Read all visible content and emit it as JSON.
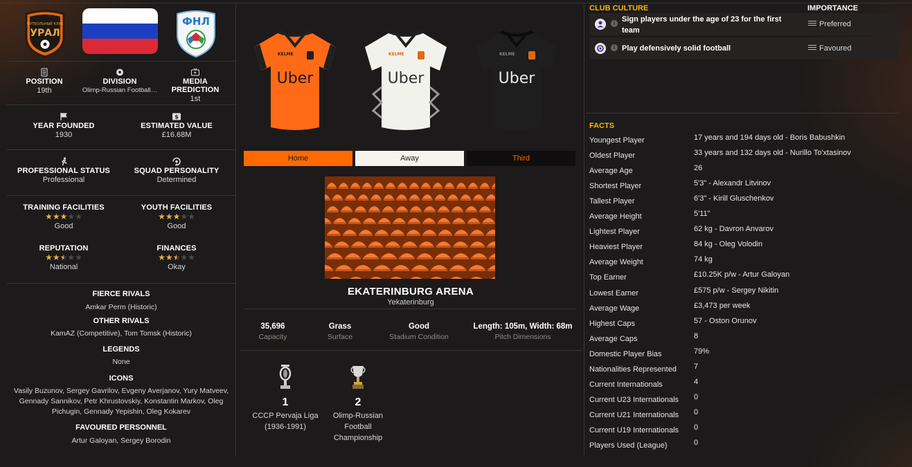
{
  "club": {
    "badge_icon": "ural-club-badge-icon",
    "country_flag_icon": "russia-flag-icon",
    "league_badge_icon": "fnl-league-badge-icon",
    "accent_color": "#ff6a00"
  },
  "overview": {
    "position": {
      "label": "POSITION",
      "value": "19th"
    },
    "division": {
      "label": "DIVISION",
      "value": "Olimp-Russian Football…"
    },
    "media_prediction": {
      "label": "MEDIA PREDICTION",
      "value": "1st"
    },
    "year_founded": {
      "label": "YEAR FOUNDED",
      "value": "1930"
    },
    "estimated_value": {
      "label": "ESTIMATED VALUE",
      "value": "£16.68M"
    },
    "professional_status": {
      "label": "PROFESSIONAL STATUS",
      "value": "Professional"
    },
    "squad_personality": {
      "label": "SQUAD PERSONALITY",
      "value": "Determined"
    },
    "training_facilities": {
      "label": "TRAINING FACILITIES",
      "value": "Good",
      "stars": 3
    },
    "youth_facilities": {
      "label": "YOUTH FACILITIES",
      "value": "Good",
      "stars": 3
    },
    "reputation": {
      "label": "REPUTATION",
      "value": "National",
      "stars": 2.5
    },
    "finances": {
      "label": "FINANCES",
      "value": "Okay",
      "stars": 2.5
    }
  },
  "relations": {
    "fierce_rivals_label": "FIERCE RIVALS",
    "fierce_rivals": "Amkar Perm (Historic)",
    "other_rivals_label": "OTHER RIVALS",
    "other_rivals": "KamAZ (Competitive), Tom Tomsk (Historic)",
    "legends_label": "LEGENDS",
    "legends": "None",
    "icons_label": "ICONS",
    "icons_line1": "Vasily Buzunov, Sergey Gavrilov, Evgeny Averjanov, Yury Matveev,",
    "icons_line2": "Gennady Sannikov, Petr Khrustovskiy, Konstantin Markov, Oleg",
    "icons_line3": "Pichugin, Gennady Yepishin, Oleg Kokarev",
    "favoured_personnel_label": "FAVOURED PERSONNEL",
    "favoured_personnel": "Artur Galoyan, Sergey Borodin"
  },
  "kits": {
    "sponsor": "Uber",
    "brand": "KELME",
    "tabs": [
      {
        "label": "Home",
        "bg": "#ff6a00",
        "color": "#1c1a1a"
      },
      {
        "label": "Away",
        "bg": "#f4f4ec",
        "color": "#1c1a1a"
      },
      {
        "label": "Third",
        "bg": "#0e0e0e",
        "color": "#ff6a00"
      }
    ]
  },
  "stadium": {
    "name": "EKATERINBURG ARENA",
    "city": "Yekaterinburg",
    "facts": [
      {
        "value": "35,696",
        "label": "Capacity"
      },
      {
        "value": "Grass",
        "label": "Surface"
      },
      {
        "value": "Good",
        "label": "Stadium Condition"
      },
      {
        "value": "Length: 105m, Width: 68m",
        "label": "Pitch Dimensions"
      }
    ]
  },
  "trophies": [
    {
      "icon": "trophy-icon",
      "count": "1",
      "name_line1": "CCCP Pervaja Liga",
      "name_line2": "(1936-1991)",
      "name_line3": ""
    },
    {
      "icon": "cup-icon",
      "count": "2",
      "name_line1": "Olimp-Russian",
      "name_line2": "Football",
      "name_line3": "Championship"
    }
  ],
  "culture": {
    "title": "CLUB CULTURE",
    "importance_title": "IMPORTANCE",
    "items": [
      {
        "line1": "Sign players under the age of 23 for the first",
        "line2": "team",
        "importance": "Preferred",
        "icon": "youth-player-icon"
      },
      {
        "line1": "Play defensively solid football",
        "line2": "",
        "importance": "Favoured",
        "icon": "defence-icon"
      }
    ]
  },
  "facts": {
    "title": "FACTS",
    "rows": [
      {
        "key": "Youngest Player",
        "value": "17 years and 194 days old - Boris Babushkin"
      },
      {
        "key": "Oldest Player",
        "value": "33 years and 132 days old - Nurillo To'xtasinov"
      },
      {
        "key": "Average Age",
        "value": "26"
      },
      {
        "key": "Shortest Player",
        "value": "5'3\" - Alexandr Litvinov"
      },
      {
        "key": "Tallest Player",
        "value": "6'3\" - Kirill Gluschenkov"
      },
      {
        "key": "Average Height",
        "value": "5'11\""
      },
      {
        "key": "Lightest Player",
        "value": "62 kg - Davron Anvarov"
      },
      {
        "key": "Heaviest Player",
        "value": "84 kg - Oleg Volodin"
      },
      {
        "key": "Average Weight",
        "value": "74 kg"
      },
      {
        "key": "Top Earner",
        "value": "£10.25K p/w - Artur Galoyan"
      },
      {
        "key": "Lowest Earner",
        "value": "£575 p/w - Sergey Nikitin"
      },
      {
        "key": "Average Wage",
        "value": "£3,473 per week"
      },
      {
        "key": "Highest Caps",
        "value": "57 - Oston Orunov"
      },
      {
        "key": "Average Caps",
        "value": "8"
      },
      {
        "key": "Domestic Player Bias",
        "value": "79%"
      },
      {
        "key": "Nationalities Represented",
        "value": "7"
      },
      {
        "key": "Current Internationals",
        "value": "4"
      },
      {
        "key": "Current U23 Internationals",
        "value": "0"
      },
      {
        "key": "Current U21 Internationals",
        "value": "0"
      },
      {
        "key": "Current U19 Internationals",
        "value": "0"
      },
      {
        "key": "Players Used (League)",
        "value": "0"
      }
    ]
  }
}
